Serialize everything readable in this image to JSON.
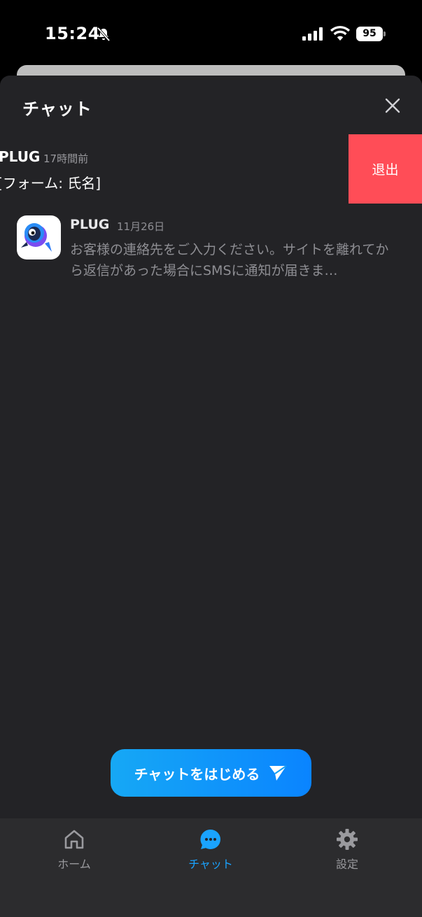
{
  "status_bar": {
    "time": "15:24",
    "battery": "95"
  },
  "sheet": {
    "title": "チャット"
  },
  "swiped_row": {
    "name": "PLUG",
    "time": "17時間前",
    "message": "[フォーム: 氏名]",
    "action_label": "退出",
    "action_color": "#ff4d57"
  },
  "row": {
    "name": "PLUG",
    "time": "11月26日",
    "message": "お客様の連絡先をご入力ください。サイトを離れてから返信があった場合にSMSに通知が届きま…"
  },
  "cta": {
    "label": "チャットをはじめる",
    "color": "#0a84ff"
  },
  "tabs": [
    {
      "label": "ホーム",
      "icon": "home-icon",
      "active": false
    },
    {
      "label": "チャット",
      "icon": "chat-bubble-icon",
      "active": true
    },
    {
      "label": "設定",
      "icon": "gear-icon",
      "active": false
    }
  ]
}
